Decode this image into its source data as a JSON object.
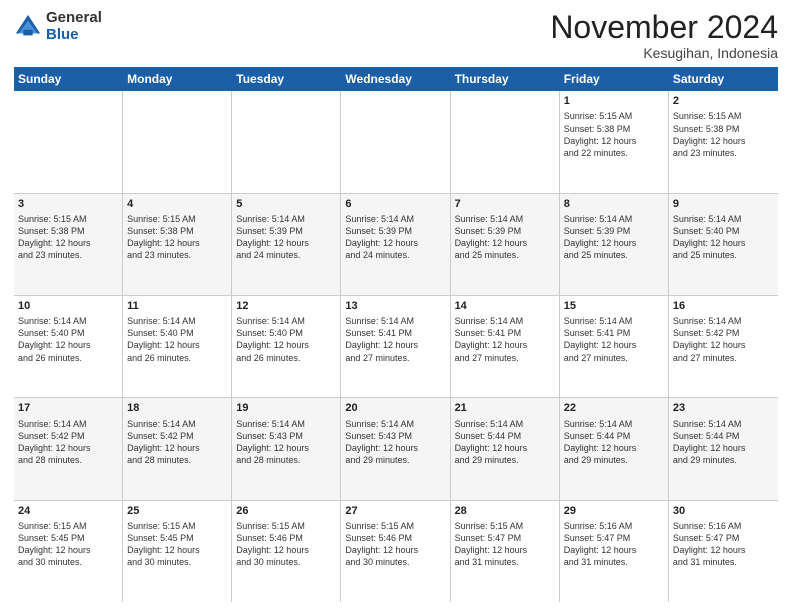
{
  "logo": {
    "general": "General",
    "blue": "Blue"
  },
  "header": {
    "month": "November 2024",
    "location": "Kesugihan, Indonesia"
  },
  "weekdays": [
    "Sunday",
    "Monday",
    "Tuesday",
    "Wednesday",
    "Thursday",
    "Friday",
    "Saturday"
  ],
  "rows": [
    {
      "alt": false,
      "cells": [
        {
          "day": "",
          "info": ""
        },
        {
          "day": "",
          "info": ""
        },
        {
          "day": "",
          "info": ""
        },
        {
          "day": "",
          "info": ""
        },
        {
          "day": "",
          "info": ""
        },
        {
          "day": "1",
          "info": "Sunrise: 5:15 AM\nSunset: 5:38 PM\nDaylight: 12 hours\nand 22 minutes."
        },
        {
          "day": "2",
          "info": "Sunrise: 5:15 AM\nSunset: 5:38 PM\nDaylight: 12 hours\nand 23 minutes."
        }
      ]
    },
    {
      "alt": true,
      "cells": [
        {
          "day": "3",
          "info": "Sunrise: 5:15 AM\nSunset: 5:38 PM\nDaylight: 12 hours\nand 23 minutes."
        },
        {
          "day": "4",
          "info": "Sunrise: 5:15 AM\nSunset: 5:38 PM\nDaylight: 12 hours\nand 23 minutes."
        },
        {
          "day": "5",
          "info": "Sunrise: 5:14 AM\nSunset: 5:39 PM\nDaylight: 12 hours\nand 24 minutes."
        },
        {
          "day": "6",
          "info": "Sunrise: 5:14 AM\nSunset: 5:39 PM\nDaylight: 12 hours\nand 24 minutes."
        },
        {
          "day": "7",
          "info": "Sunrise: 5:14 AM\nSunset: 5:39 PM\nDaylight: 12 hours\nand 25 minutes."
        },
        {
          "day": "8",
          "info": "Sunrise: 5:14 AM\nSunset: 5:39 PM\nDaylight: 12 hours\nand 25 minutes."
        },
        {
          "day": "9",
          "info": "Sunrise: 5:14 AM\nSunset: 5:40 PM\nDaylight: 12 hours\nand 25 minutes."
        }
      ]
    },
    {
      "alt": false,
      "cells": [
        {
          "day": "10",
          "info": "Sunrise: 5:14 AM\nSunset: 5:40 PM\nDaylight: 12 hours\nand 26 minutes."
        },
        {
          "day": "11",
          "info": "Sunrise: 5:14 AM\nSunset: 5:40 PM\nDaylight: 12 hours\nand 26 minutes."
        },
        {
          "day": "12",
          "info": "Sunrise: 5:14 AM\nSunset: 5:40 PM\nDaylight: 12 hours\nand 26 minutes."
        },
        {
          "day": "13",
          "info": "Sunrise: 5:14 AM\nSunset: 5:41 PM\nDaylight: 12 hours\nand 27 minutes."
        },
        {
          "day": "14",
          "info": "Sunrise: 5:14 AM\nSunset: 5:41 PM\nDaylight: 12 hours\nand 27 minutes."
        },
        {
          "day": "15",
          "info": "Sunrise: 5:14 AM\nSunset: 5:41 PM\nDaylight: 12 hours\nand 27 minutes."
        },
        {
          "day": "16",
          "info": "Sunrise: 5:14 AM\nSunset: 5:42 PM\nDaylight: 12 hours\nand 27 minutes."
        }
      ]
    },
    {
      "alt": true,
      "cells": [
        {
          "day": "17",
          "info": "Sunrise: 5:14 AM\nSunset: 5:42 PM\nDaylight: 12 hours\nand 28 minutes."
        },
        {
          "day": "18",
          "info": "Sunrise: 5:14 AM\nSunset: 5:42 PM\nDaylight: 12 hours\nand 28 minutes."
        },
        {
          "day": "19",
          "info": "Sunrise: 5:14 AM\nSunset: 5:43 PM\nDaylight: 12 hours\nand 28 minutes."
        },
        {
          "day": "20",
          "info": "Sunrise: 5:14 AM\nSunset: 5:43 PM\nDaylight: 12 hours\nand 29 minutes."
        },
        {
          "day": "21",
          "info": "Sunrise: 5:14 AM\nSunset: 5:44 PM\nDaylight: 12 hours\nand 29 minutes."
        },
        {
          "day": "22",
          "info": "Sunrise: 5:14 AM\nSunset: 5:44 PM\nDaylight: 12 hours\nand 29 minutes."
        },
        {
          "day": "23",
          "info": "Sunrise: 5:14 AM\nSunset: 5:44 PM\nDaylight: 12 hours\nand 29 minutes."
        }
      ]
    },
    {
      "alt": false,
      "cells": [
        {
          "day": "24",
          "info": "Sunrise: 5:15 AM\nSunset: 5:45 PM\nDaylight: 12 hours\nand 30 minutes."
        },
        {
          "day": "25",
          "info": "Sunrise: 5:15 AM\nSunset: 5:45 PM\nDaylight: 12 hours\nand 30 minutes."
        },
        {
          "day": "26",
          "info": "Sunrise: 5:15 AM\nSunset: 5:46 PM\nDaylight: 12 hours\nand 30 minutes."
        },
        {
          "day": "27",
          "info": "Sunrise: 5:15 AM\nSunset: 5:46 PM\nDaylight: 12 hours\nand 30 minutes."
        },
        {
          "day": "28",
          "info": "Sunrise: 5:15 AM\nSunset: 5:47 PM\nDaylight: 12 hours\nand 31 minutes."
        },
        {
          "day": "29",
          "info": "Sunrise: 5:16 AM\nSunset: 5:47 PM\nDaylight: 12 hours\nand 31 minutes."
        },
        {
          "day": "30",
          "info": "Sunrise: 5:16 AM\nSunset: 5:47 PM\nDaylight: 12 hours\nand 31 minutes."
        }
      ]
    }
  ]
}
